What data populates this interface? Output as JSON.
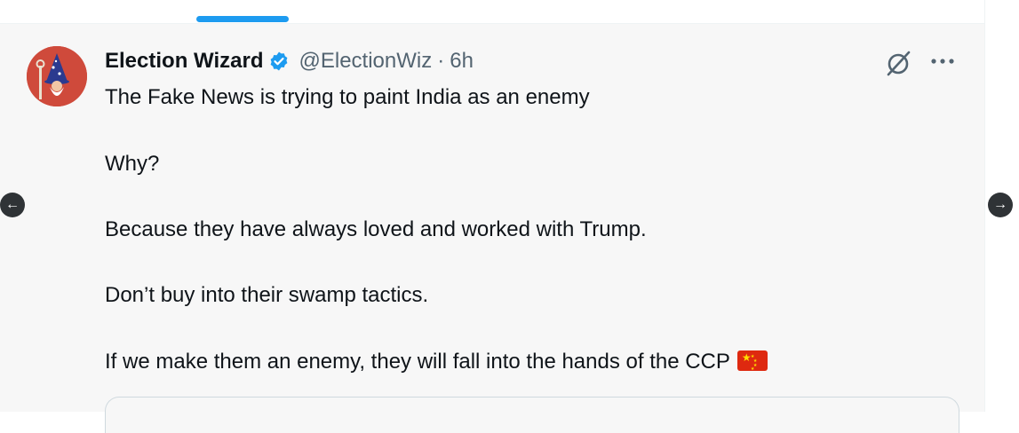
{
  "tweet": {
    "display_name": "Election Wizard",
    "handle": "@ElectionWiz",
    "separator": "·",
    "time": "6h",
    "verified": true,
    "lines": [
      "The Fake News is trying to paint India as an enemy",
      "Why?",
      "Because they have always loved and worked with Trump.",
      "Don’t buy into their swamp tactics.",
      "If we make them an enemy, they will fall into the hands of the CCP"
    ],
    "flag_icon": "china-flag-icon"
  },
  "navigation": {
    "prev_icon": "arrow-left-icon",
    "next_icon": "arrow-right-icon"
  },
  "colors": {
    "accent": "#1d9bf0",
    "text": "#0f1419",
    "muted": "#536471",
    "tweet_bg": "#f7f7f7",
    "avatar_bg": "#cf4a3b",
    "flag_red": "#de2910",
    "flag_yellow": "#ffde00"
  }
}
